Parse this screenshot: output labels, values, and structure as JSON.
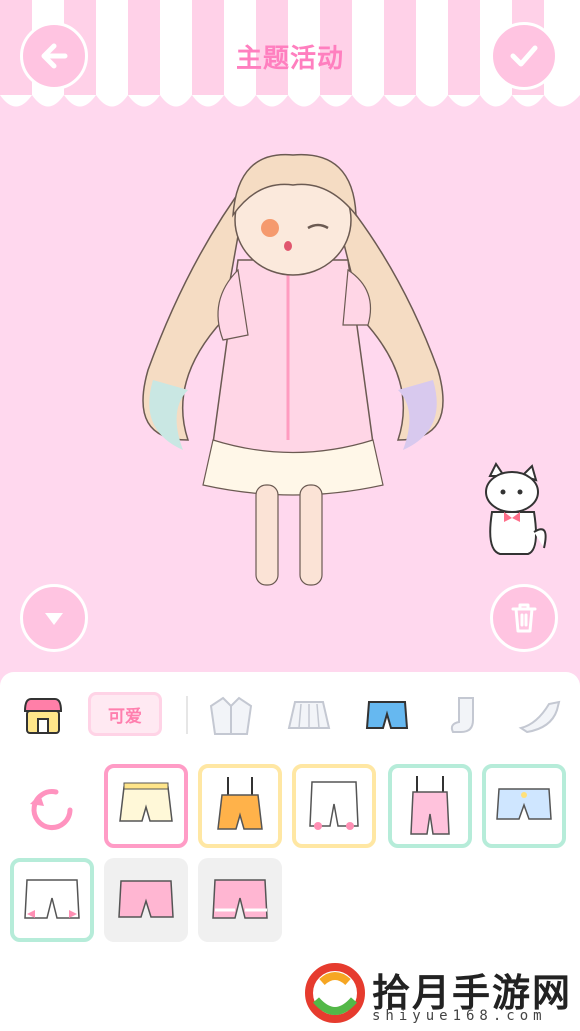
{
  "header": {
    "title": "主题活动"
  },
  "toolbar": {
    "cute_label": "可爱"
  },
  "watermark": {
    "brand": "拾月手游网",
    "url": "shiyue168.com"
  },
  "colors": {
    "background": "#ffd8ee",
    "accent": "#ff7fbf",
    "button": "#ffc4e1"
  },
  "icons": [
    "back-arrow-icon",
    "check-icon",
    "chevron-down-icon",
    "trash-icon",
    "shop-icon",
    "jacket-icon",
    "skirt-icon",
    "shorts-icon",
    "sock-icon",
    "heel-icon",
    "refresh-icon"
  ]
}
